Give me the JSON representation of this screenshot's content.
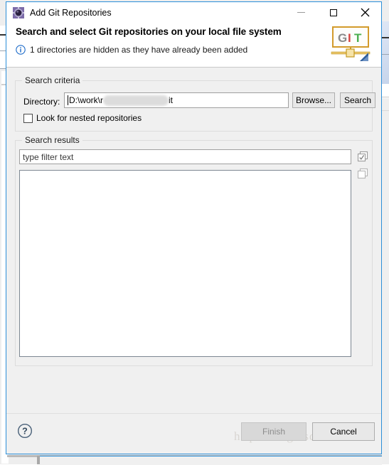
{
  "window": {
    "title": "Add Git Repositories",
    "icon": "git-repository-gear-icon",
    "controls": {
      "minimize": "minimize-icon",
      "maximize": "maximize-icon",
      "close": "close-icon"
    }
  },
  "header": {
    "title": "Search and select Git repositories on your local file system",
    "message": "1 directories are hidden as they have already been added",
    "message_icon": "info-icon",
    "logo": {
      "text_g": "G",
      "text_i": "I",
      "text_t": "T",
      "color_g": "#8a8a8a",
      "color_i": "#d64541",
      "color_t": "#4caf50",
      "border_color": "#d39b2b"
    }
  },
  "search_criteria": {
    "legend": "Search criteria",
    "directory_label": "Directory:",
    "directory_value_visible_start": "D:\\work\\r",
    "directory_value_visible_end": "it",
    "directory_redacted": true,
    "browse_button": "Browse...",
    "search_button": "Search",
    "nested_checkbox_label": "Look for nested repositories",
    "nested_checkbox_checked": false
  },
  "search_results": {
    "legend": "Search results",
    "filter_placeholder": "type filter text",
    "filter_value": "type filter text",
    "items": [],
    "select_all_icon": "select-all-icon",
    "deselect_all_icon": "deselect-all-icon"
  },
  "footer": {
    "help_icon": "help-question-icon",
    "finish_button": "Finish",
    "finish_enabled": false,
    "cancel_button": "Cancel"
  },
  "watermark": {
    "text": "http://blog.csdn.net/"
  },
  "colors": {
    "dialog_border": "#2c8fd8",
    "dialog_bg": "#f0f0f0",
    "header_bg": "#ffffff",
    "info_blue": "#1b6ac9",
    "accent": "#2c8fd8"
  }
}
